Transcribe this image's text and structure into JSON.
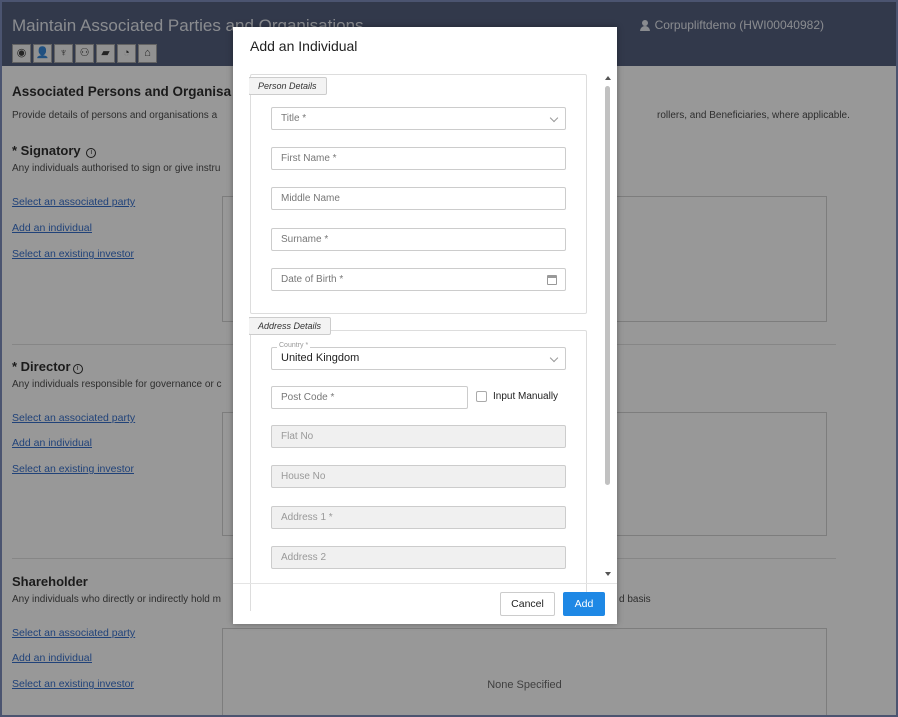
{
  "app": {
    "title": "Maintain Associated Parties and Organisations",
    "user": "Corpupliftdemo (HWI00040982)"
  },
  "toolbar": [
    "globe-icon",
    "person-icon",
    "trophy-icon",
    "people-icon",
    "folder-icon",
    "clock-icon",
    "bank-icon"
  ],
  "page": {
    "heading": "Associated Persons and Organisa",
    "description": "Provide details of persons and organisations a",
    "description_right": "rollers, and Beneficiaries, where applicable.",
    "sections": [
      {
        "title": "* Signatory",
        "desc": "Any individuals authorised to sign or give instru",
        "links": [
          "Select an associated party",
          "Add an individual",
          "Select an existing investor"
        ]
      },
      {
        "title": "* Director",
        "desc": "Any individuals responsible for governance or c",
        "links": [
          "Select an associated party",
          "Add an individual",
          "Select an existing investor"
        ]
      },
      {
        "title": "Shareholder",
        "desc": "Any individuals who directly or indirectly hold m",
        "desc_right": "d basis",
        "links": [
          "Select an associated party",
          "Add an individual",
          "Select an existing investor"
        ],
        "box_text": "None Specified"
      }
    ]
  },
  "modal": {
    "title": "Add an Individual",
    "person_legend": "Person Details",
    "address_legend": "Address Details",
    "fields": {
      "title": "Title *",
      "first_name": "First Name *",
      "middle_name": "Middle Name",
      "surname": "Surname *",
      "dob": "Date of Birth *",
      "country_label": "Country *",
      "country_value": "United Kingdom",
      "post_code": "Post Code *",
      "input_manually": "Input Manually",
      "flat_no": "Flat No",
      "house_no": "House No",
      "address1": "Address 1 *",
      "address2": "Address 2"
    },
    "cancel": "Cancel",
    "add": "Add"
  }
}
